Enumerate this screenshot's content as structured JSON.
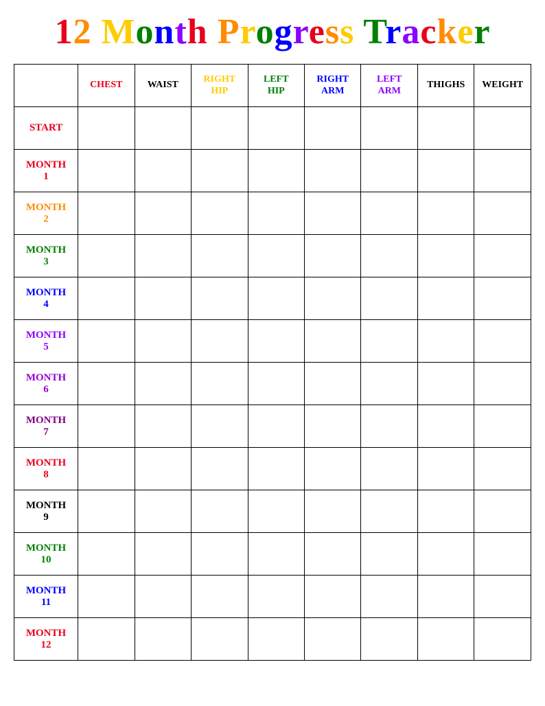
{
  "title": {
    "full": "12 Month Progress Tracker",
    "chars": [
      {
        "text": "1",
        "class": "title-1"
      },
      {
        "text": "2",
        "class": "title-2"
      },
      {
        "text": " ",
        "class": "title-3"
      },
      {
        "text": "M",
        "class": "title-3"
      },
      {
        "text": "o",
        "class": "title-4"
      },
      {
        "text": "n",
        "class": "title-5"
      },
      {
        "text": "t",
        "class": "title-6"
      },
      {
        "text": "h",
        "class": "title-7"
      },
      {
        "text": " ",
        "class": "title-8"
      },
      {
        "text": "P",
        "class": "title-8"
      },
      {
        "text": "r",
        "class": "title-9"
      },
      {
        "text": "o",
        "class": "title-10"
      },
      {
        "text": "g",
        "class": "title-11"
      },
      {
        "text": "r",
        "class": "title-12"
      },
      {
        "text": "e",
        "class": "title-1"
      },
      {
        "text": "s",
        "class": "title-2"
      },
      {
        "text": "s",
        "class": "title-3"
      },
      {
        "text": " ",
        "class": "title-4"
      },
      {
        "text": "T",
        "class": "title-4"
      },
      {
        "text": "r",
        "class": "title-5"
      },
      {
        "text": "a",
        "class": "title-6"
      },
      {
        "text": "c",
        "class": "title-7"
      },
      {
        "text": "k",
        "class": "title-8"
      },
      {
        "text": "e",
        "class": "title-9"
      },
      {
        "text": "r",
        "class": "title-10"
      }
    ]
  },
  "headers": {
    "col0": "",
    "chest": "CHEST",
    "waist": "WAIST",
    "rhip_line1": "RIGHT",
    "rhip_line2": "HIP",
    "lhip_line1": "LEFT",
    "lhip_line2": "HIP",
    "rarm_line1": "RIGHT",
    "rarm_line2": "ARM",
    "larm_line1": "LEFT",
    "larm_line2": "ARM",
    "thighs": "THIGHS",
    "weight": "WEIGHT"
  },
  "rows": [
    {
      "label_line1": "START",
      "label_line2": "",
      "class": "start-label"
    },
    {
      "label_line1": "MONTH",
      "label_line2": "1",
      "class": "m1-label"
    },
    {
      "label_line1": "MONTH",
      "label_line2": "2",
      "class": "m2-label"
    },
    {
      "label_line1": "MONTH",
      "label_line2": "3",
      "class": "m3-label"
    },
    {
      "label_line1": "MONTH",
      "label_line2": "4",
      "class": "m4-label"
    },
    {
      "label_line1": "MONTH",
      "label_line2": "5",
      "class": "m5-label"
    },
    {
      "label_line1": "MONTH",
      "label_line2": "6",
      "class": "m6-label"
    },
    {
      "label_line1": "MONTH",
      "label_line2": "7",
      "class": "m7-label"
    },
    {
      "label_line1": "MONTH",
      "label_line2": "8",
      "class": "m8-label"
    },
    {
      "label_line1": "MONTH",
      "label_line2": "9",
      "class": "m9-label"
    },
    {
      "label_line1": "MONTH",
      "label_line2": "10",
      "class": "m10-label"
    },
    {
      "label_line1": "MONTH",
      "label_line2": "11",
      "class": "m11-label"
    },
    {
      "label_line1": "MONTH",
      "label_line2": "12",
      "class": "m12-label"
    }
  ]
}
